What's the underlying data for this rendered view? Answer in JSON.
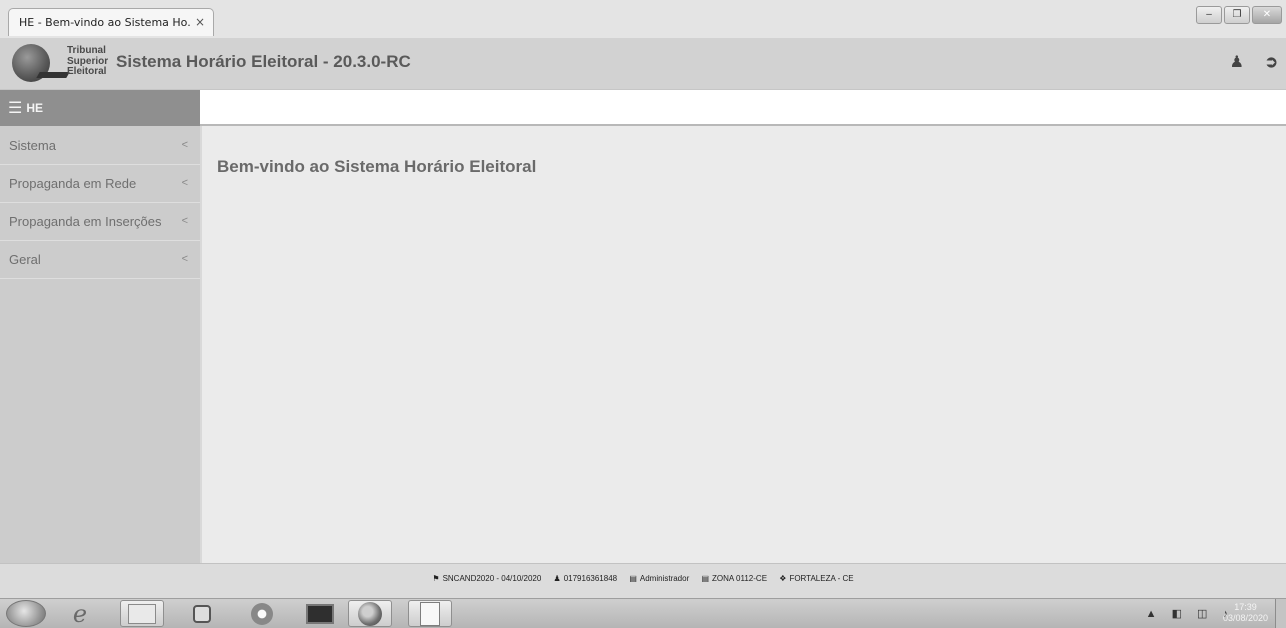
{
  "browser": {
    "tab_title": "HE - Bem-vindo ao Sistema Ho...",
    "tab_close": "×",
    "window_buttons": {
      "minimize": "–",
      "restore": "❐",
      "close": "✕"
    }
  },
  "header": {
    "logo_lines": [
      "Tribunal",
      "Superior",
      "Eleitoral"
    ],
    "title": "Sistema Horário Eleitoral - 20.3.0-RC",
    "user_icon": "user-icon",
    "logout_icon": "logout-icon"
  },
  "sidebar": {
    "toggle_label": "HE",
    "items": [
      {
        "label": "Sistema",
        "chevron": "<"
      },
      {
        "label": "Propaganda em Rede",
        "chevron": "<"
      },
      {
        "label": "Propaganda em Inserções",
        "chevron": "<"
      },
      {
        "label": "Geral",
        "chevron": "<"
      }
    ]
  },
  "main": {
    "welcome": "Bem-vindo ao Sistema Horário Eleitoral"
  },
  "footer": {
    "version": "SNCAND2020 - 04/10/2020",
    "user_id": "017916361848",
    "profile": "Administrador",
    "zone": "ZONA 0112-CE",
    "location": "FORTALEZA - CE"
  },
  "taskbar": {
    "time": "17:39",
    "date": "03/08/2020"
  },
  "colors": {
    "sidebar_bg": "#cccccc",
    "sidebar_toggle_bg": "#8f8f8f",
    "header_bg": "#d2d2d2",
    "main_bg": "#ebebeb"
  }
}
